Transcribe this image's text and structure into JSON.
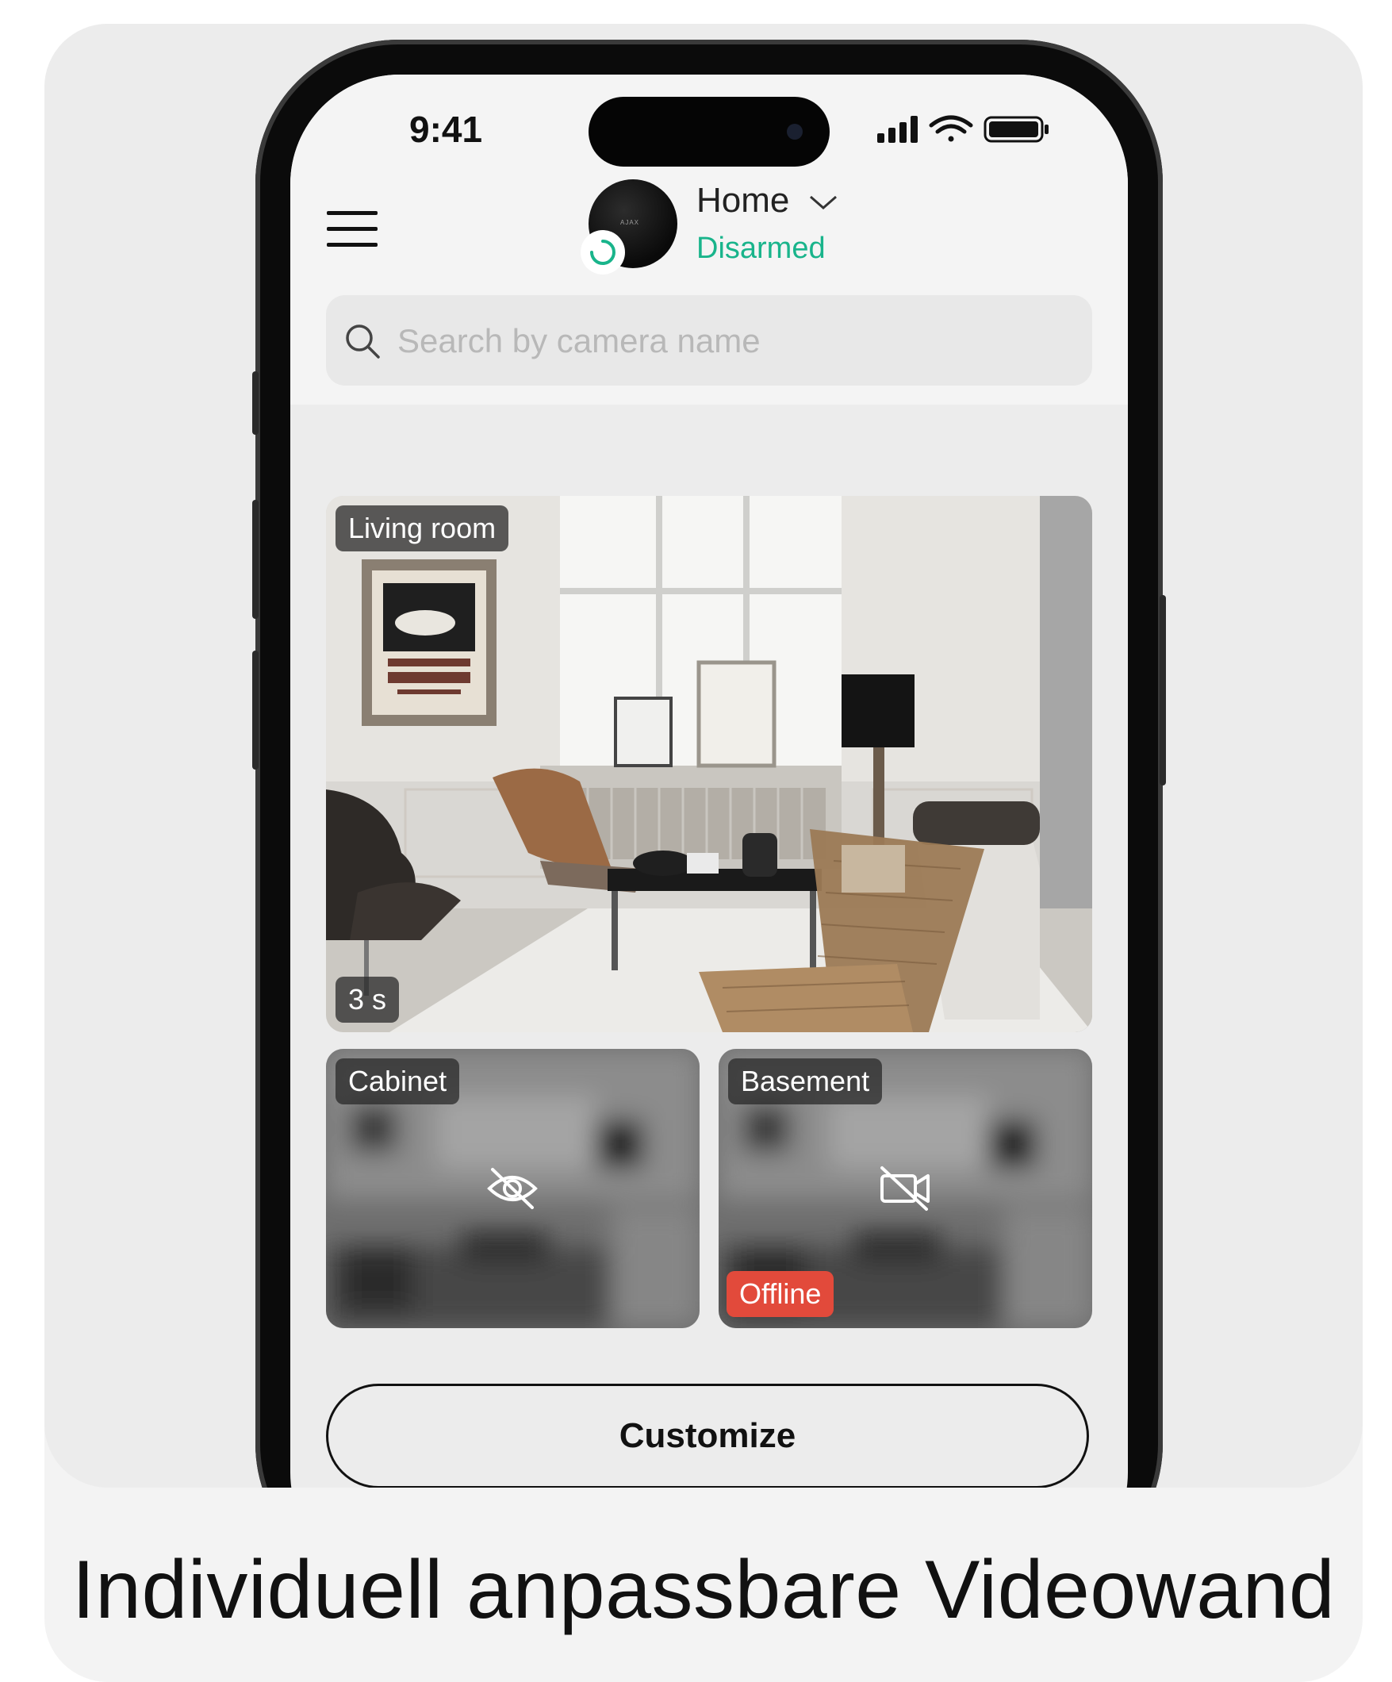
{
  "status_bar": {
    "time": "9:41"
  },
  "header": {
    "hub_name": "Home",
    "hub_status": "Disarmed",
    "hub_brand": "AJAX",
    "status_color": "#19b48b"
  },
  "search": {
    "placeholder": "Search by camera name",
    "value": ""
  },
  "cameras": [
    {
      "name": "Living room",
      "stream_duration": "3 s",
      "state": "live"
    },
    {
      "name": "Cabinet",
      "state": "privacy",
      "icon": "eye-off-icon"
    },
    {
      "name": "Basement",
      "state": "offline",
      "icon": "camera-off-icon",
      "badge": "Offline"
    }
  ],
  "actions": {
    "customize_label": "Customize"
  },
  "caption": "Individuell anpassbare Videowand",
  "colors": {
    "offline_badge": "#e24a3b",
    "background": "#ececec"
  }
}
